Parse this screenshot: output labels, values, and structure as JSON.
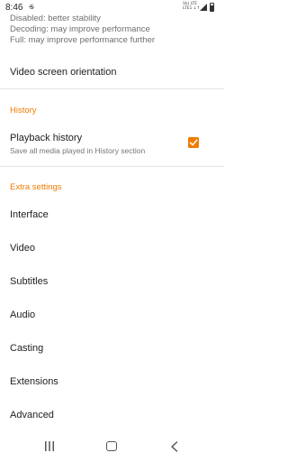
{
  "status_bar": {
    "time": "8:46",
    "notification_glyph": "ꜱ̶",
    "network_line1": "Vo) LTE",
    "network_line2": "LTE1 ↓↑",
    "icons": [
      "notification-icon",
      "signal-icon",
      "battery-icon"
    ]
  },
  "top_item": {
    "summary_lines": [
      "Disabled: better stability",
      "Decoding: may improve performance",
      "Full: may improve performance further"
    ]
  },
  "video_orientation": {
    "title": "Video screen orientation"
  },
  "history_section": {
    "header": "History",
    "playback_history": {
      "title": "Playback history",
      "summary": "Save all media played in History section",
      "checked": true
    }
  },
  "extra_section": {
    "header": "Extra settings",
    "items": [
      "Interface",
      "Video",
      "Subtitles",
      "Audio",
      "Casting",
      "Extensions",
      "Advanced"
    ]
  },
  "nav_bar": {
    "icons": [
      "recents-icon",
      "home-icon",
      "back-icon"
    ]
  },
  "colors": {
    "accent": "#f07b00",
    "divider": "#e3e3e3"
  }
}
